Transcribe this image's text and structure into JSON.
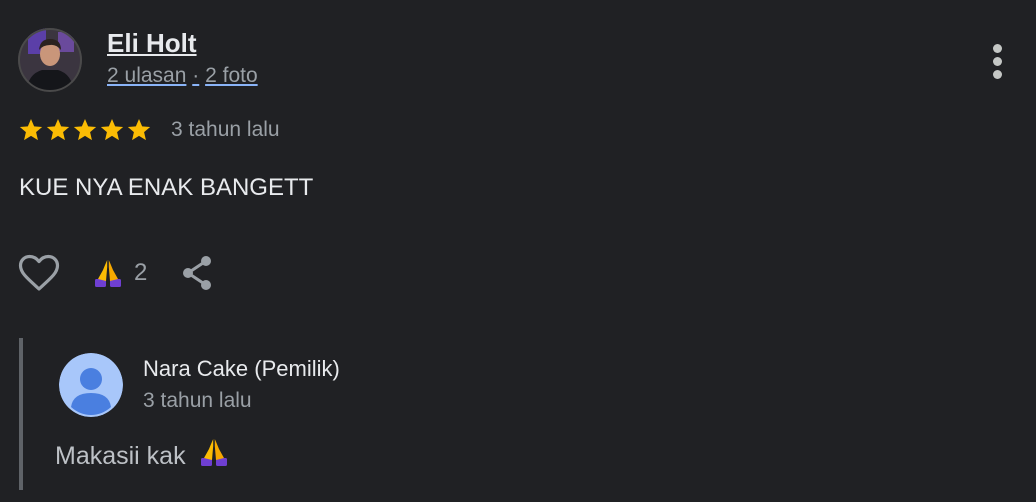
{
  "reviewer": {
    "name": "Eli Holt",
    "reviews": "2 ulasan",
    "separator": "·",
    "photos": "2 foto"
  },
  "rating": {
    "stars": 5,
    "max": 5,
    "star_color": "#fbbc04"
  },
  "review": {
    "time": "3 tahun lalu",
    "text": "KUE NYA ENAK BANGETT"
  },
  "actions": {
    "like_icon": "heart-outline-icon",
    "reaction_icon": "folded-hands-emoji",
    "reaction_count": "2",
    "share_icon": "share-icon",
    "more_icon": "more-vertical-icon"
  },
  "owner_response": {
    "name": "Nara Cake (Pemilik)",
    "time": "3 tahun lalu",
    "text": "Makasii kak",
    "emoji_icon": "folded-hands-emoji",
    "avatar_icon": "default-profile-icon"
  },
  "colors": {
    "background": "#202124",
    "text_primary": "#e8eaed",
    "text_secondary": "#9aa0a6",
    "link_underline": "#8ab4f8",
    "reply_border": "#5f6368"
  }
}
